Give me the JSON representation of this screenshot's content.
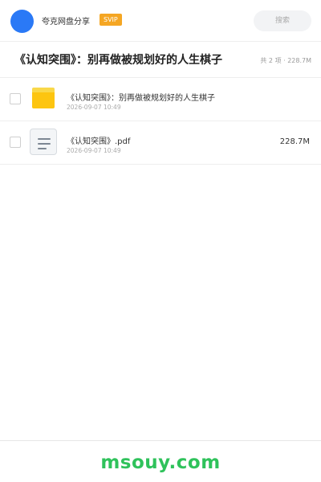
{
  "header": {
    "app_name": "夸克网盘分享",
    "badge": "SVIP",
    "search_placeholder": "搜索"
  },
  "share": {
    "title": "《认知突围》：别再做被规划好的人生棋子",
    "summary": "共 2 项 · 228.7M"
  },
  "files": [
    {
      "name": "《认知突围》：别再做被规划好的人生棋子",
      "date": "2026-09-07 10:49",
      "size": "",
      "icon": "folder-icon"
    },
    {
      "name": "《认知突围》.pdf",
      "date": "2026-09-07 10:49",
      "size": "228.7M",
      "icon": "document-icon"
    }
  ],
  "footer": {
    "watermark": "msouy.com"
  },
  "colors": {
    "avatar": "#2a79f6",
    "svip_badge": "#f5a623",
    "folder": "#fdc510",
    "watermark": "#2fc25b"
  }
}
